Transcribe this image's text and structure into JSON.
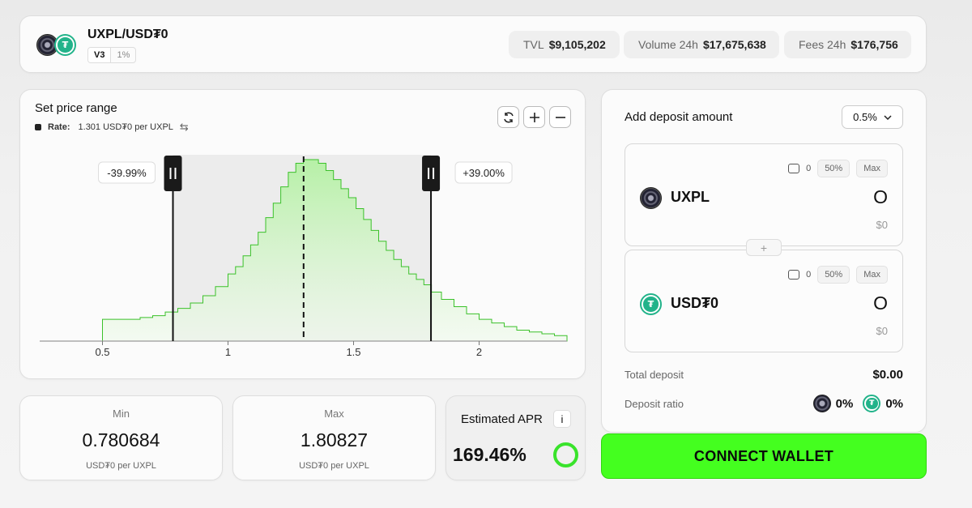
{
  "pair": {
    "title": "UXPL/USD₮0",
    "version": "V3",
    "fee_tier": "1%",
    "token_a_icon": "uxpl-token-icon",
    "token_b_icon": "usdt0-token-icon"
  },
  "stats": [
    {
      "label": "TVL",
      "value": "$9,105,202"
    },
    {
      "label": "Volume 24h",
      "value": "$17,675,638"
    },
    {
      "label": "Fees 24h",
      "value": "$176,756"
    }
  ],
  "range": {
    "title": "Set price range",
    "rate_label": "Rate:",
    "rate_value": "1.301 USD₮0 per UXPL",
    "lower_pct": "-39.99%",
    "upper_pct": "+39.00%",
    "controls": [
      "refresh-icon",
      "zoom-in-icon",
      "zoom-out-icon"
    ]
  },
  "chart_data": {
    "type": "area",
    "x_ticks": [
      "0.5",
      "1",
      "1.5",
      "2"
    ],
    "xlim": [
      0.25,
      2.35
    ],
    "current_price": 1.301,
    "range_min": 0.780684,
    "range_max": 1.80827,
    "step_x": [
      0.5,
      0.55,
      0.6,
      0.65,
      0.7,
      0.75,
      0.8,
      0.85,
      0.9,
      0.95,
      1.0,
      1.03,
      1.06,
      1.09,
      1.12,
      1.15,
      1.18,
      1.21,
      1.24,
      1.27,
      1.3,
      1.33,
      1.36,
      1.39,
      1.42,
      1.45,
      1.48,
      1.51,
      1.54,
      1.57,
      1.6,
      1.63,
      1.66,
      1.69,
      1.72,
      1.75,
      1.78,
      1.81,
      1.85,
      1.9,
      1.95,
      2.0,
      2.05,
      2.1,
      2.15,
      2.2,
      2.25,
      2.3,
      2.35
    ],
    "density": [
      0.12,
      0.12,
      0.12,
      0.13,
      0.14,
      0.16,
      0.18,
      0.21,
      0.25,
      0.3,
      0.37,
      0.41,
      0.47,
      0.53,
      0.6,
      0.68,
      0.76,
      0.85,
      0.93,
      0.98,
      1.0,
      1.0,
      0.98,
      0.94,
      0.89,
      0.84,
      0.79,
      0.73,
      0.67,
      0.61,
      0.55,
      0.5,
      0.45,
      0.41,
      0.37,
      0.34,
      0.31,
      0.27,
      0.23,
      0.19,
      0.15,
      0.12,
      0.1,
      0.08,
      0.06,
      0.05,
      0.04,
      0.03,
      0.02
    ]
  },
  "min": {
    "title": "Min",
    "value": "0.780684",
    "unit": "USD₮0 per UXPL"
  },
  "max": {
    "title": "Max",
    "value": "1.80827",
    "unit": "USD₮0 per UXPL"
  },
  "apr": {
    "title": "Estimated APR",
    "info": "i",
    "value": "169.46%",
    "color": "#39e32b"
  },
  "deposit": {
    "title": "Add deposit amount",
    "slippage": "0.5%",
    "tokens": [
      {
        "name": "UXPL",
        "balance": "0",
        "half": "50%",
        "max": "Max",
        "amount": "O",
        "usd": "$0"
      },
      {
        "name": "USD₮0",
        "balance": "0",
        "half": "50%",
        "max": "Max",
        "amount": "O",
        "usd": "$0"
      }
    ],
    "add": "+",
    "total_label": "Total deposit",
    "total_value": "$0.00",
    "ratio_label": "Deposit ratio",
    "ratio_a": "0%",
    "ratio_b": "0%"
  },
  "connect_label": "CONNECT WALLET",
  "colors": {
    "accent": "#44ff1f",
    "usdt": "#22b38a",
    "chart_fill": "#b6f0a6",
    "chart_line": "#3bc12a"
  }
}
